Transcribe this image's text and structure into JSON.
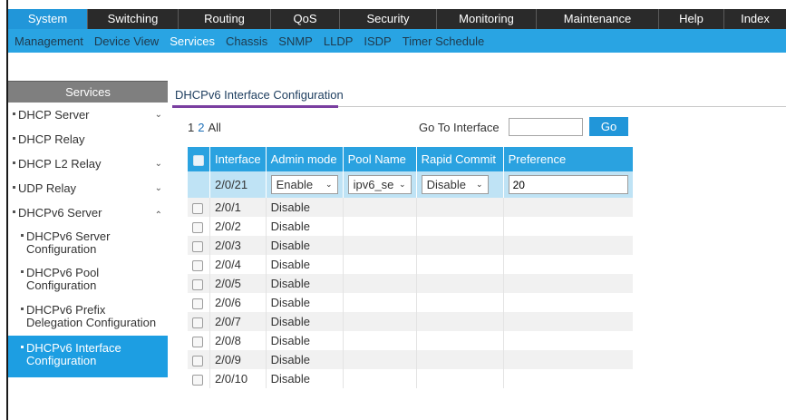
{
  "topnav": [
    "System",
    "Switching",
    "Routing",
    "QoS",
    "Security",
    "Monitoring",
    "Maintenance",
    "Help",
    "Index"
  ],
  "topnav_active": "System",
  "subnav": [
    "Management",
    "Device View",
    "Services",
    "Chassis",
    "SNMP",
    "LLDP",
    "ISDP",
    "Timer Schedule"
  ],
  "subnav_active": "Services",
  "sidebar": {
    "header": "Services",
    "items": [
      {
        "label": "DHCP Server",
        "chevron": "down"
      },
      {
        "label": "DHCP Relay",
        "chevron": ""
      },
      {
        "label": "DHCP L2 Relay",
        "chevron": "down"
      },
      {
        "label": "UDP Relay",
        "chevron": "down"
      },
      {
        "label": "DHCPv6 Server",
        "chevron": "up"
      }
    ],
    "subitems": [
      {
        "line1": "DHCPv6 Server",
        "line2": "Configuration"
      },
      {
        "line1": "DHCPv6 Pool",
        "line2": "Configuration"
      },
      {
        "line1": "DHCPv6 Prefix",
        "line2": "Delegation Configuration"
      },
      {
        "line1": "DHCPv6 Interface",
        "line2": "Configuration"
      }
    ],
    "active_subitem": 3
  },
  "main": {
    "title": "DHCPv6 Interface Configuration",
    "pager": {
      "pages": [
        "1",
        "2",
        "All"
      ],
      "selected": "2"
    },
    "goto_label": "Go To Interface",
    "goto_value": "",
    "go_label": "Go",
    "columns": [
      "Interface",
      "Admin mode",
      "Pool Name",
      "Rapid Commit",
      "Preference"
    ],
    "edit_row": {
      "interface": "2/0/21",
      "admin_mode": "Enable",
      "pool_name": "ipv6_se",
      "rapid_commit": "Disable",
      "preference": "20"
    },
    "rows": [
      {
        "interface": "2/0/1",
        "admin_mode": "Disable"
      },
      {
        "interface": "2/0/2",
        "admin_mode": "Disable"
      },
      {
        "interface": "2/0/3",
        "admin_mode": "Disable"
      },
      {
        "interface": "2/0/4",
        "admin_mode": "Disable"
      },
      {
        "interface": "2/0/5",
        "admin_mode": "Disable"
      },
      {
        "interface": "2/0/6",
        "admin_mode": "Disable"
      },
      {
        "interface": "2/0/7",
        "admin_mode": "Disable"
      },
      {
        "interface": "2/0/8",
        "admin_mode": "Disable"
      },
      {
        "interface": "2/0/9",
        "admin_mode": "Disable"
      },
      {
        "interface": "2/0/10",
        "admin_mode": "Disable"
      }
    ]
  },
  "colors": {
    "accent": "#2196d9",
    "subnav_bg": "#29a4e3",
    "topnav_bg": "#2a2a2a",
    "sidebar_header_bg": "#7f7f7f",
    "title_underline": "#7a3fa0",
    "edit_row_bg": "#bfe3f5"
  }
}
